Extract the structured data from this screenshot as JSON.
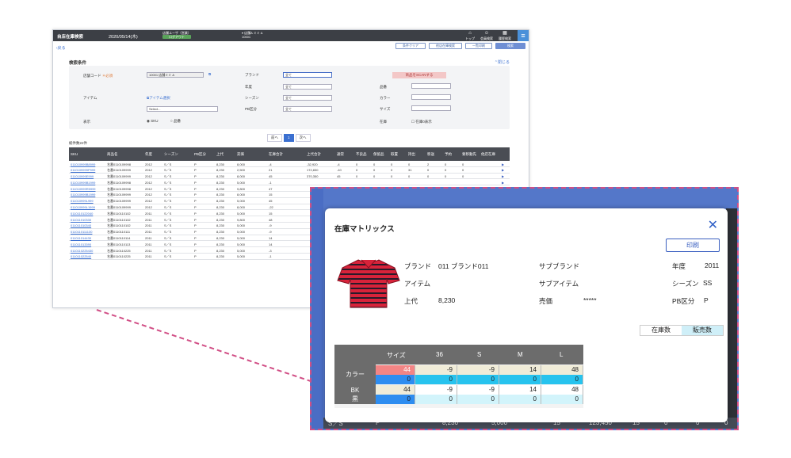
{
  "app": {
    "title": "自店在庫検索",
    "date": "2020/05/14(木)",
    "user_label": "店舗ユーザ（営業）",
    "logout_label": "ログアウト",
    "store_label": "店舗A ミミ A",
    "store_code": "10001",
    "nav": [
      "トップ",
      "会員検索",
      "履歴検索"
    ],
    "menu_icon": "hamburger-icon"
  },
  "actionbar": {
    "back_label": "戻る",
    "buttons": [
      "条件クリア",
      "他店在庫検索",
      "一覧印刷",
      "検索"
    ]
  },
  "search": {
    "title": "検索条件",
    "close_label": "閉じる",
    "store_code_label": "店舗コード",
    "required_mark": "＊必須",
    "store_code_value": "10001 店舗ミミ A",
    "item_label": "アイテム",
    "item_select_link": "アイテム選択",
    "item_select_placeholder": "Select...",
    "display_label": "表示",
    "display_options": [
      "SKU",
      "品番"
    ],
    "brand_label": "ブランド",
    "year_label": "年度",
    "season_label": "シーズン",
    "pb_label": "PB区分",
    "all_value": "全て",
    "scan_button": "商品をSCANする",
    "hinban_label": "品番",
    "color_label": "カラー",
    "size_label": "サイズ",
    "stock_label": "在庫",
    "stock_zero_label": "在庫0表示"
  },
  "pager": {
    "prev": "前へ",
    "current": "1",
    "next": "次へ"
  },
  "result_count": "総件数22件",
  "table": {
    "headers": [
      "SKU",
      "商品名",
      "年度",
      "シーズン",
      "PB区分",
      "上代",
      "売価",
      "在庫合計",
      "上代合計",
      "通常",
      "不良品",
      "保留品",
      "取置",
      "持出",
      "移送",
      "予約",
      "要移動先",
      "他店在庫"
    ],
    "rows": [
      [
        "011010999B8999",
        "名番0110109998",
        "2012",
        "S／S",
        "P",
        "8,230",
        "8,000",
        "-4",
        "-32,920",
        "-4",
        "0",
        "0",
        "0",
        "0",
        "2",
        "0",
        "0"
      ],
      [
        "0110109999P999",
        "名番0110109999",
        "2012",
        "S／S",
        "P",
        "8,230",
        "2,500",
        "21",
        "172,830",
        "-10",
        "0",
        "0",
        "0",
        "31",
        "0",
        "0",
        "0"
      ],
      [
        "011010999E999",
        "名番0110109999",
        "2012",
        "S／S",
        "P",
        "8,230",
        "8,000",
        "45",
        "370,350",
        "45",
        "0",
        "0",
        "0",
        "0",
        "0",
        "0",
        "0"
      ],
      [
        "011010999B1999",
        "名番0110109998",
        "2012",
        "S／S",
        "P",
        "8,230",
        "5,000",
        "-1",
        "",
        "",
        "",
        "",
        "",
        "",
        "",
        "",
        ""
      ],
      [
        "011010999R5999",
        "名番0110109998",
        "2012",
        "S／S",
        "P",
        "8,230",
        "9,800",
        "47",
        "",
        "",
        "",
        "",
        "",
        "",
        "",
        "",
        ""
      ],
      [
        "011010999B1999",
        "名番0110109999",
        "2012",
        "S／S",
        "P",
        "8,230",
        "8,000",
        "15",
        "",
        "",
        "",
        "",
        "",
        "",
        "",
        "",
        ""
      ],
      [
        "011010999L999",
        "名番0110109999",
        "2012",
        "S／S",
        "P",
        "8,230",
        "5,000",
        "45",
        "",
        "",
        "",
        "",
        "",
        "",
        "",
        "",
        ""
      ],
      [
        "011010999L1999",
        "名番0110109999",
        "2012",
        "S／S",
        "P",
        "8,230",
        "8,000",
        "-22",
        "",
        "",
        "",
        "",
        "",
        "",
        "",
        "",
        ""
      ],
      [
        "0110110122040",
        "名番0110110102",
        "2011",
        "S／S",
        "P",
        "8,230",
        "5,000",
        "15",
        "",
        "",
        "",
        "",
        "",
        "",
        "",
        "",
        ""
      ],
      [
        "011011010330",
        "名番0110110102",
        "2011",
        "S／S",
        "P",
        "8,230",
        "9,800",
        "48",
        "",
        "",
        "",
        "",
        "",
        "",
        "",
        "",
        ""
      ],
      [
        "011011010340",
        "名番0110110102",
        "2011",
        "S／S",
        "P",
        "8,230",
        "5,000",
        "-9",
        "",
        "",
        "",
        "",
        "",
        "",
        "",
        "",
        ""
      ],
      [
        "0110110111130",
        "名番0110110111",
        "2011",
        "S／S",
        "P",
        "8,230",
        "5,000",
        "-9",
        "",
        "",
        "",
        "",
        "",
        "",
        "",
        "",
        ""
      ],
      [
        "011011014430",
        "名番0110110114",
        "2011",
        "S／S",
        "P",
        "8,230",
        "5,000",
        "14",
        "",
        "",
        "",
        "",
        "",
        "",
        "",
        "",
        ""
      ],
      [
        "011011013390",
        "名番0110110113",
        "2011",
        "S／S",
        "P",
        "8,230",
        "5,000",
        "14",
        "",
        "",
        "",
        "",
        "",
        "",
        "",
        "",
        ""
      ],
      [
        "0110110225430",
        "名番0110110225",
        "2011",
        "S／S",
        "P",
        "8,230",
        "5,000",
        "-3",
        "",
        "",
        "",
        "",
        "",
        "",
        "",
        "",
        ""
      ],
      [
        "011011022540",
        "名番0110110225",
        "2011",
        "S／S",
        "P",
        "8,230",
        "5,000",
        "-1",
        "",
        "",
        "",
        "",
        "",
        "",
        "",
        "",
        ""
      ]
    ]
  },
  "zoom_bg_row": [
    "S／S",
    "P",
    "8,230",
    "5,000",
    "15",
    "123,450",
    "15",
    "0",
    "0",
    "0"
  ],
  "modal": {
    "title": "在庫マトリックス",
    "close_icon": "close-icon",
    "print_label": "印刷",
    "product_image": "polo-shirt-image",
    "brand_label": "ブランド",
    "brand_value": "011 ブランド011",
    "item_label": "アイテム",
    "list_price_label": "上代",
    "list_price_value": "8,230",
    "sub_brand_label": "サブブランド",
    "sub_item_label": "サブアイテム",
    "sale_price_label": "売価",
    "sale_price_value": "*****",
    "year_label": "年度",
    "year_value": "2011",
    "season_label": "シーズン",
    "season_value": "SS",
    "pb_label": "PB区分",
    "pb_value": "P",
    "toggle": [
      "在庫数",
      "販売数"
    ],
    "matrix": {
      "size_header": "サイズ",
      "sizes": [
        "36",
        "S",
        "M",
        "L"
      ],
      "color_header": "カラー",
      "total_row": [
        "44",
        "-9",
        "-9",
        "14",
        "48"
      ],
      "total_row_sales": [
        "0",
        "0",
        "0",
        "0",
        "0"
      ],
      "color_code": "BK",
      "color_name": "黒",
      "bk_row": [
        "44",
        "-9",
        "-9",
        "14",
        "48"
      ],
      "bk_row_sales": [
        "0",
        "0",
        "0",
        "0",
        "0"
      ]
    }
  },
  "colors": {
    "accent": "#3a6fd0",
    "callout_border": "#d14f86",
    "topbar": "#3c3f45"
  }
}
